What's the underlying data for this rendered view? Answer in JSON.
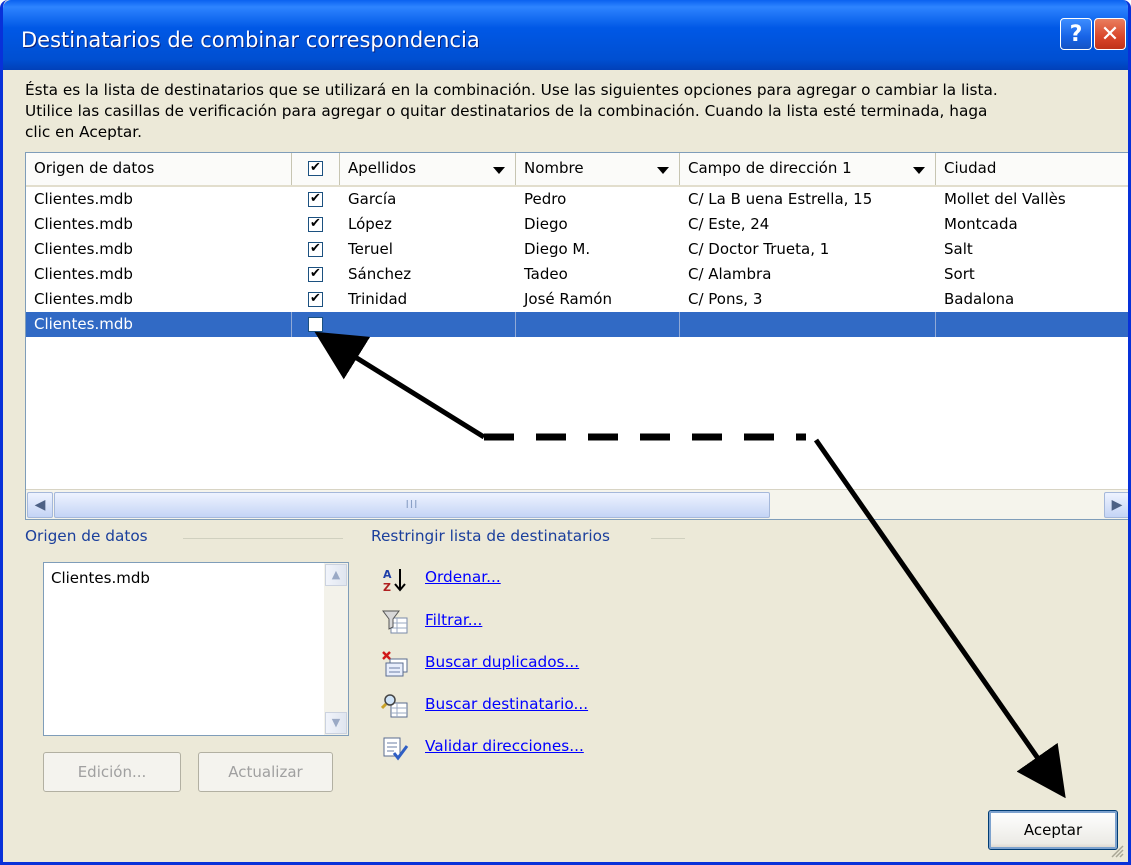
{
  "window": {
    "title": "Destinatarios de combinar correspondencia",
    "help_label": "?",
    "close_label": "✕"
  },
  "description": [
    "Ésta es la lista de destinatarios que se utilizará en la combinación. Use las siguientes opciones para agregar o cambiar la lista.",
    "Utilice las casillas de verificación para agregar o quitar destinatarios de la combinación. Cuando la lista esté terminada, haga",
    "clic en Aceptar."
  ],
  "table": {
    "columns": [
      "Origen de datos",
      "",
      "Apellidos",
      "Nombre",
      "Campo de dirección 1",
      "Ciudad"
    ],
    "header_checked": true,
    "rows": [
      {
        "origen": "Clientes.mdb",
        "checked": true,
        "apellidos": "García",
        "nombre": "Pedro",
        "direccion": "C/ La B uena Estrella, 15",
        "ciudad": "Mollet del Vallès"
      },
      {
        "origen": "Clientes.mdb",
        "checked": true,
        "apellidos": "López",
        "nombre": "Diego",
        "direccion": "C/ Este, 24",
        "ciudad": "Montcada"
      },
      {
        "origen": "Clientes.mdb",
        "checked": true,
        "apellidos": "Teruel",
        "nombre": "Diego M.",
        "direccion": "C/ Doctor Trueta, 1",
        "ciudad": "Salt"
      },
      {
        "origen": "Clientes.mdb",
        "checked": true,
        "apellidos": "Sánchez",
        "nombre": "Tadeo",
        "direccion": "C/ Alambra",
        "ciudad": "Sort"
      },
      {
        "origen": "Clientes.mdb",
        "checked": true,
        "apellidos": "Trinidad",
        "nombre": "José Ramón",
        "direccion": "C/ Pons, 3",
        "ciudad": "Badalona"
      },
      {
        "origen": "Clientes.mdb",
        "checked": false,
        "apellidos": "",
        "nombre": "",
        "direccion": "",
        "ciudad": ""
      }
    ],
    "selected_row": 6,
    "scroll_thumb_label": "III"
  },
  "datasource": {
    "title": "Origen de datos",
    "items": [
      "Clientes.mdb"
    ],
    "edit_label": "Edición...",
    "refresh_label": "Actualizar"
  },
  "restrict": {
    "title": "Restringir lista de destinatarios",
    "links": [
      {
        "label": "Ordenar...",
        "icon": "sort-icon"
      },
      {
        "label": "Filtrar...",
        "icon": "filter-icon"
      },
      {
        "label": "Buscar duplicados...",
        "icon": "duplicates-icon"
      },
      {
        "label": "Buscar destinatario...",
        "icon": "find-recipient-icon"
      },
      {
        "label": "Validar direcciones...",
        "icon": "validate-icon"
      }
    ]
  },
  "ok_label": "Aceptar"
}
